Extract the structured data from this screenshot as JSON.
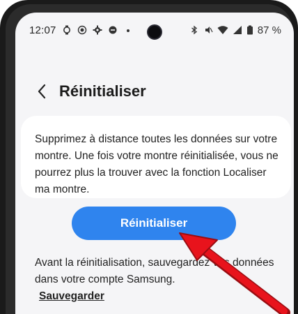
{
  "status_bar": {
    "time": "12:07",
    "battery": "87 %"
  },
  "header": {
    "title": "Réinitialiser"
  },
  "card": {
    "description": "Supprimez à distance toutes les données sur votre montre. Une fois votre montre réinitialisée, vous ne pourrez plus la trouver avec la fonction Localiser ma montre."
  },
  "actions": {
    "reset_label": "Réinitialiser",
    "backup_note": "Avant la réinitialisation, sauvegardez vos données dans votre compte Samsung.",
    "backup_link": "Sauvegarder"
  },
  "colors": {
    "accent": "#2f84ee",
    "annotation": "#e8131c"
  }
}
